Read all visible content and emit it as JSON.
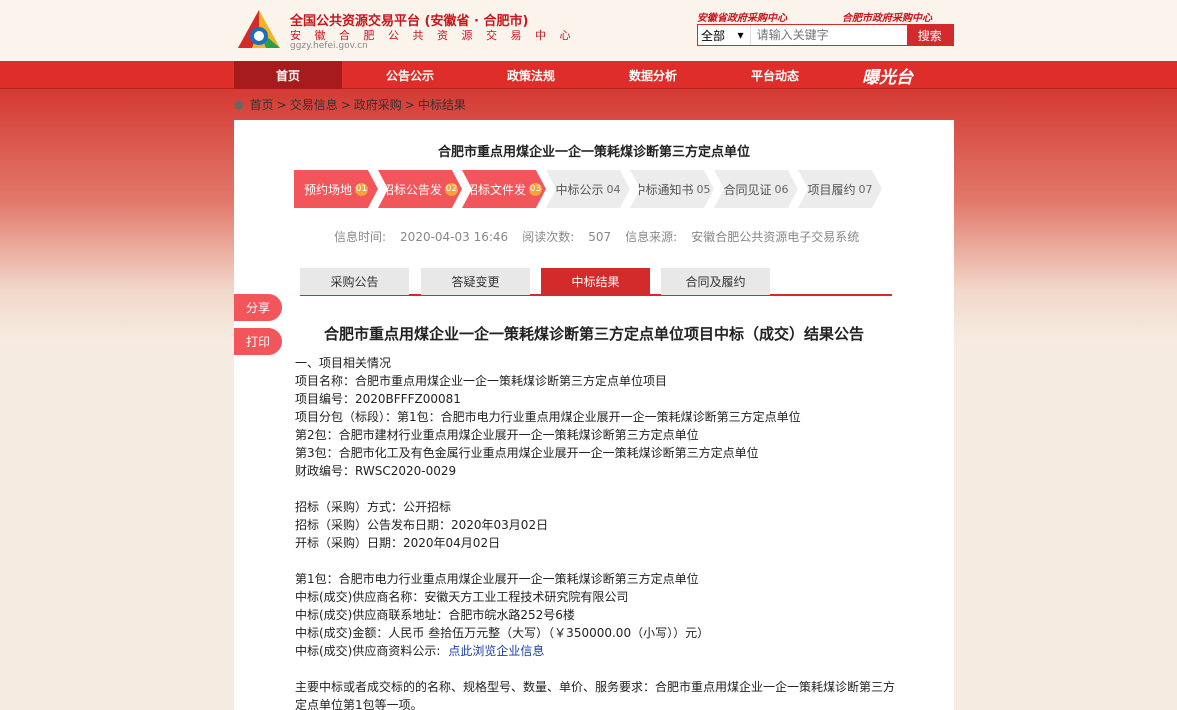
{
  "header": {
    "title": "全国公共资源交易平台 (安徽省 · 合肥市)",
    "subtitle": "安 徽 合 肥 公 共 资 源 交 易 中 心",
    "url": "ggzy.hefei.gov.cn",
    "partner1": "安徽省政府采购中心",
    "partner2": "合肥市政府采购中心"
  },
  "search": {
    "scope": "全部",
    "placeholder": "请输入关键字",
    "button": "搜索"
  },
  "nav": {
    "items": [
      "首页",
      "公告公示",
      "政策法规",
      "数据分析",
      "平台动态"
    ],
    "brand": "曝光台"
  },
  "breadcrumb": [
    "首页",
    ">",
    "交易信息",
    ">",
    "政府采购",
    ">",
    "中标结果"
  ],
  "page_title": "合肥市重点用煤企业一企一策耗煤诊断第三方定点单位",
  "steps": [
    {
      "label": "预约场地",
      "num": "01"
    },
    {
      "label": "招标公告发布",
      "num": "02"
    },
    {
      "label": "招标文件发布",
      "num": "03"
    },
    {
      "label": "中标公示",
      "num": "04"
    },
    {
      "label": "中标通知书",
      "num": "05"
    },
    {
      "label": "合同见证",
      "num": "06"
    },
    {
      "label": "项目履约",
      "num": "07"
    }
  ],
  "meta": {
    "time_label": "信息时间:",
    "time": "2020-04-03 16:46",
    "views_label": "阅读次数:",
    "views": "507",
    "source_label": "信息来源:",
    "source": "安徽合肥公共资源电子交易系统"
  },
  "tabs": [
    "采购公告",
    "答疑变更",
    "中标结果",
    "合同及履约"
  ],
  "side": {
    "share": "分享",
    "print": "打印"
  },
  "notice": {
    "title": "合肥市重点用煤企业一企一策耗煤诊断第三方定点单位项目中标（成交）结果公告",
    "lines": [
      "一、项目相关情况",
      "项目名称：合肥市重点用煤企业一企一策耗煤诊断第三方定点单位项目",
      "项目编号：2020BFFFZ00081",
      "项目分包（标段）：第1包：合肥市电力行业重点用煤企业展开一企一策耗煤诊断第三方定点单位",
      "第2包：合肥市建材行业重点用煤企业展开一企一策耗煤诊断第三方定点单位",
      "第3包：合肥市化工及有色金属行业重点用煤企业展开一企一策耗煤诊断第三方定点单位",
      "财政编号：RWSC2020-0029",
      "",
      "招标（采购）方式：公开招标",
      "招标（采购）公告发布日期：2020年03月02日",
      "开标（采购）日期：2020年04月02日",
      "",
      "第1包：合肥市电力行业重点用煤企业展开一企一策耗煤诊断第三方定点单位",
      "中标(成交)供应商名称：安徽天方工业工程技术研究院有限公司",
      "中标(成交)供应商联系地址：合肥市皖水路252号6楼",
      "中标(成交)金额：人民币 叁拾伍万元整（大写）（￥350000.00（小写））元）"
    ],
    "materials_label": "中标(成交)供应商资料公示:",
    "materials_link": "点此浏览企业信息",
    "summary": "主要中标或者成交标的的名称、规格型号、数量、单价、服务要求：合肥市重点用煤企业一企一策耗煤诊断第三方定点单位第1包等一项。"
  }
}
